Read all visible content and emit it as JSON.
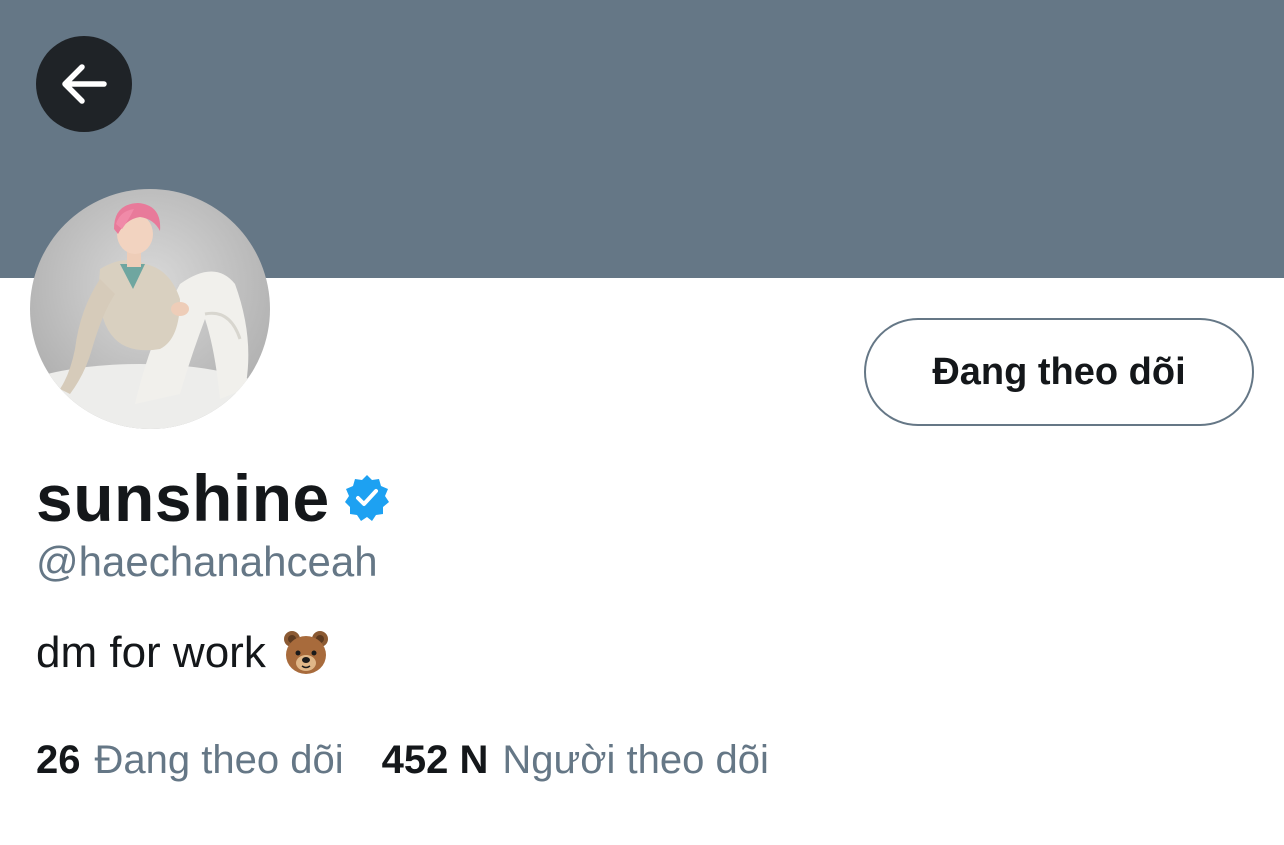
{
  "header": {
    "back_icon": "arrow-left-icon",
    "banner_color": "#657786"
  },
  "profile": {
    "display_name": "sunshine",
    "verified_icon": "verified-badge-icon",
    "verified_color": "#1da1f2",
    "handle": "@haechanahceah",
    "bio_text": "dm for work",
    "bio_emoji": "bear-face-icon"
  },
  "actions": {
    "follow_label": "Đang theo dõi"
  },
  "stats": {
    "following_count": "26",
    "following_label": "Đang theo dõi",
    "followers_count": "452 N",
    "followers_label": "Người theo dõi"
  }
}
